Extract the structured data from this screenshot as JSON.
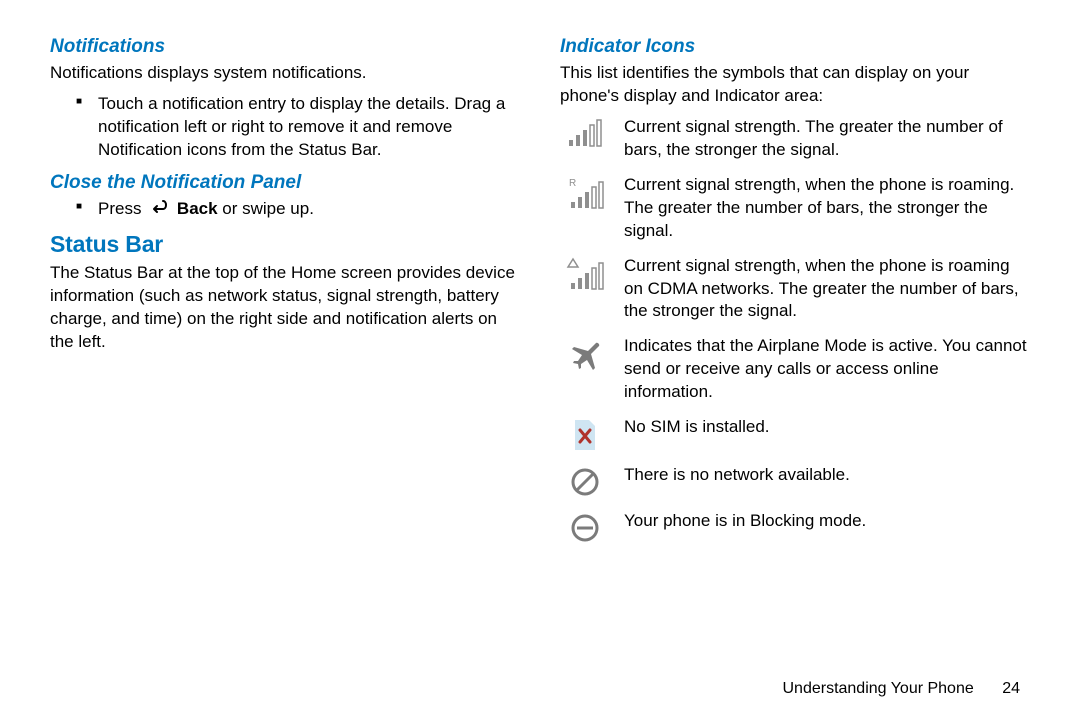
{
  "left": {
    "h_notifications": "Notifications",
    "notif_text": "Notifications displays system notifications.",
    "notif_bullet": "Touch a notification entry to display the details. Drag a notification left or right to remove it and remove Notification icons from the Status Bar.",
    "h_close": "Close the Notification Panel",
    "close_press": "Press ",
    "close_bold": "Back",
    "close_rest": " or swipe up.",
    "h_status": "Status Bar",
    "status_text": "The Status Bar at the top of the Home screen provides device information (such as network status, signal strength, battery charge, and time) on the right side and notification alerts on the left."
  },
  "right": {
    "h_indicator": "Indicator Icons",
    "intro": "This list identifies the symbols that can display on your phone's display and Indicator area:",
    "rows": {
      "signal": "Current signal strength. The greater the number of bars, the stronger the signal.",
      "signal_r": "Current signal strength, when the phone is roaming. The greater the number of bars, the stronger the signal.",
      "signal_cdma": "Current signal strength, when the phone is roaming on CDMA networks. The greater the number of bars, the stronger the signal.",
      "airplane": "Indicates that the Airplane Mode is active. You cannot send or receive any calls or access online information.",
      "nosim": "No SIM is installed.",
      "nonet": "There is no network available.",
      "blocking": "Your phone is in Blocking mode."
    }
  },
  "footer": {
    "chapter": "Understanding Your Phone",
    "page": "24"
  }
}
